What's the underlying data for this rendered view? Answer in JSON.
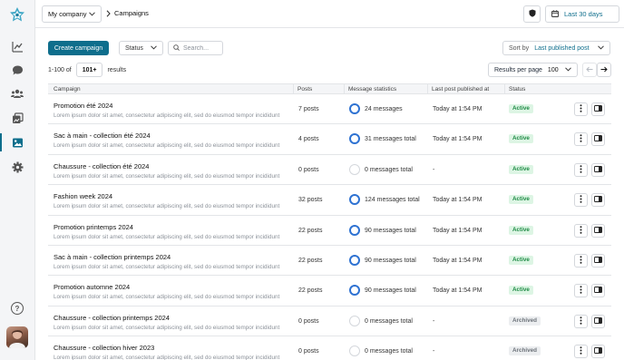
{
  "topbar": {
    "company": "My company",
    "breadcrumb": "Campaigns",
    "date_range": "Last 30 days"
  },
  "toolbar": {
    "create_label": "Create campaign",
    "status_filter": "Status",
    "search_placeholder": "Search...",
    "sort_label": "Sort by",
    "sort_value": "Last published post"
  },
  "pagination": {
    "range_prefix": "1-100 of",
    "total": "101+",
    "range_suffix": "results",
    "rpp_label": "Results per page",
    "rpp_value": "100"
  },
  "columns": {
    "campaign": "Campaign",
    "posts": "Posts",
    "message_statistics": "Message statistics",
    "last_post": "Last post published at",
    "status": "Status"
  },
  "rows": [
    {
      "name": "Promotion été 2024",
      "desc": "Lorem ipsum dolor sit amet, consectetur adipiscing elit, sed do eiusmod tempor incididunt",
      "posts": "7 posts",
      "messages": "24 messages",
      "last": "Today at 1:54 PM",
      "status": "Active",
      "ring": "filled"
    },
    {
      "name": "Sac à main - collection été 2024",
      "desc": "Lorem ipsum dolor sit amet, consectetur adipiscing elit, sed do eiusmod tempor incididunt",
      "posts": "4 posts",
      "messages": "31 messages total",
      "last": "Today at 1:54 PM",
      "status": "Active",
      "ring": "filled"
    },
    {
      "name": "Chaussure - collection été 2024",
      "desc": "Lorem ipsum dolor sit amet, consectetur adipiscing elit, sed do eiusmod tempor incididunt",
      "posts": "0 posts",
      "messages": "0 messages total",
      "last": "-",
      "status": "Active",
      "ring": "empty"
    },
    {
      "name": "Fashion week 2024",
      "desc": "Lorem ipsum dolor sit amet, consectetur adipiscing elit, sed do eiusmod tempor incididunt",
      "posts": "32 posts",
      "messages": "124 messages total",
      "last": "Today at 1:54 PM",
      "status": "Active",
      "ring": "filled"
    },
    {
      "name": "Promotion printemps 2024",
      "desc": "Lorem ipsum dolor sit amet, consectetur adipiscing elit, sed do eiusmod tempor incididunt",
      "posts": "22 posts",
      "messages": "90 messages total",
      "last": "Today at 1:54 PM",
      "status": "Active",
      "ring": "filled"
    },
    {
      "name": "Sac à main - collection printemps 2024",
      "desc": "Lorem ipsum dolor sit amet, consectetur adipiscing elit, sed do eiusmod tempor incididunt",
      "posts": "22 posts",
      "messages": "90 messages total",
      "last": "Today at 1:54 PM",
      "status": "Active",
      "ring": "filled"
    },
    {
      "name": "Promotion automne 2024",
      "desc": "Lorem ipsum dolor sit amet, consectetur adipiscing elit, sed do eiusmod tempor incididunt",
      "posts": "22 posts",
      "messages": "90 messages total",
      "last": "Today at 1:54 PM",
      "status": "Active",
      "ring": "filled"
    },
    {
      "name": "Chaussure - collection printemps 2024",
      "desc": "Lorem ipsum dolor sit amet, consectetur adipiscing elit, sed do eiusmod tempor incididunt",
      "posts": "0 posts",
      "messages": "0 messages total",
      "last": "-",
      "status": "Archived",
      "ring": "empty"
    },
    {
      "name": "Chaussure - collection hiver 2023",
      "desc": "Lorem ipsum dolor sit amet, consectetur adipiscing elit, sed do eiusmod tempor incididunt",
      "posts": "0 posts",
      "messages": "0 messages total",
      "last": "-",
      "status": "Archived",
      "ring": "empty"
    }
  ],
  "colors": {
    "accent": "#0e6e8c",
    "ring": "#2e72d2",
    "active_bg": "#ddf5e4",
    "active_fg": "#1e8a45",
    "archived_bg": "#eceef0",
    "archived_fg": "#6b7178"
  },
  "icons": {
    "sidebar": [
      "analytics-icon",
      "chat-icon",
      "users-icon",
      "media-library-icon",
      "campaigns-icon",
      "settings-icon",
      "help-icon"
    ]
  }
}
